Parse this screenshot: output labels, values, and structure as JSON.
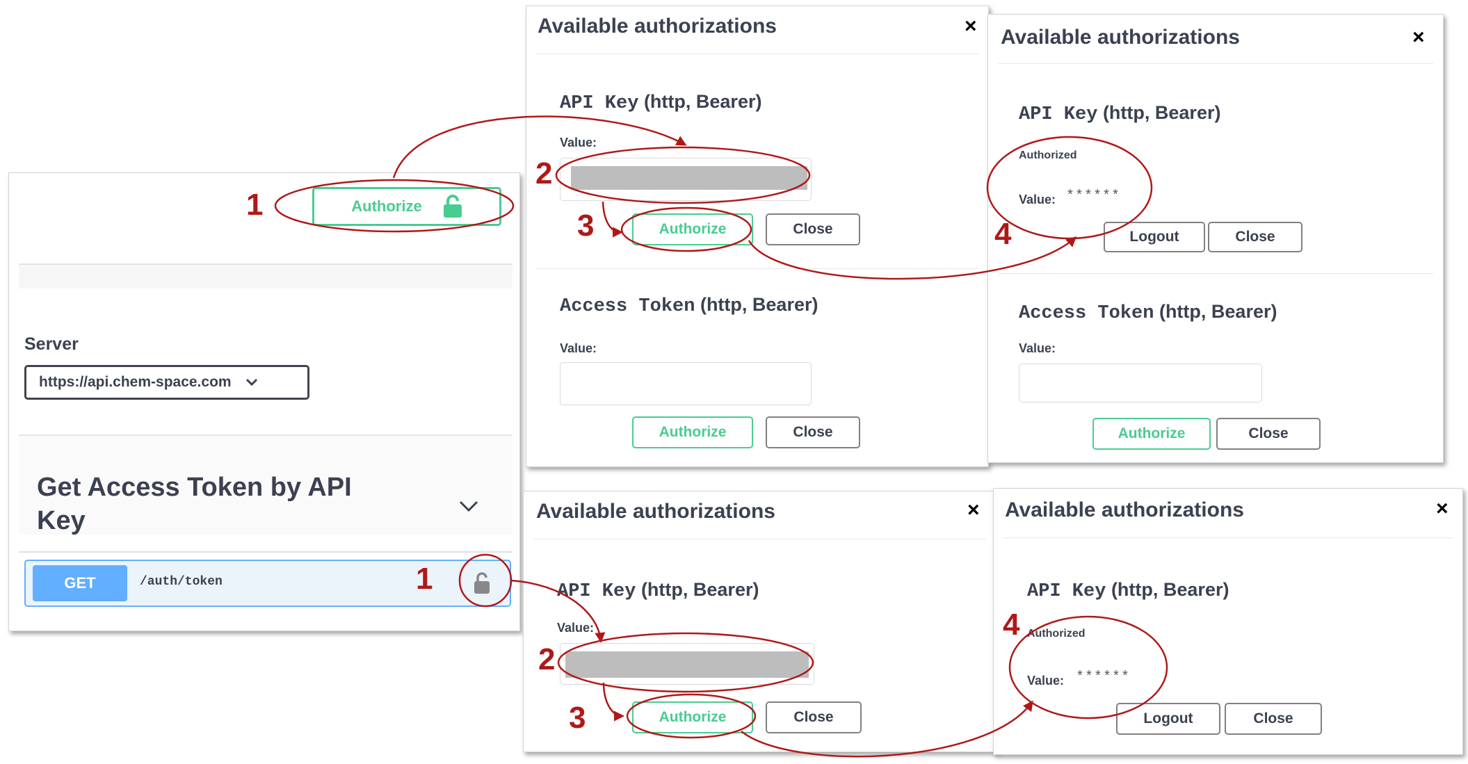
{
  "left_panel": {
    "authorize_button": "Authorize",
    "server_label": "Server",
    "server_select": "https://api.chem-space.com",
    "section_title": "Get Access Token by API Key",
    "method": "GET",
    "path": "/auth/token"
  },
  "dialog_title": "Available authorizations",
  "close_x": "×",
  "api_key_name": "API Key",
  "api_key_scheme": "(http, Bearer)",
  "access_token_name": "Access Token",
  "access_token_scheme": "(http, Bearer)",
  "value_label": "Value:",
  "authorized_label": "Authorized",
  "masked_value": "******",
  "buttons": {
    "authorize": "Authorize",
    "close": "Close",
    "logout": "Logout"
  },
  "steps": [
    "1",
    "2",
    "3",
    "4"
  ],
  "colors": {
    "annotation_red": "#b01818",
    "authorize_green": "#49cc90",
    "get_blue": "#61affe"
  }
}
